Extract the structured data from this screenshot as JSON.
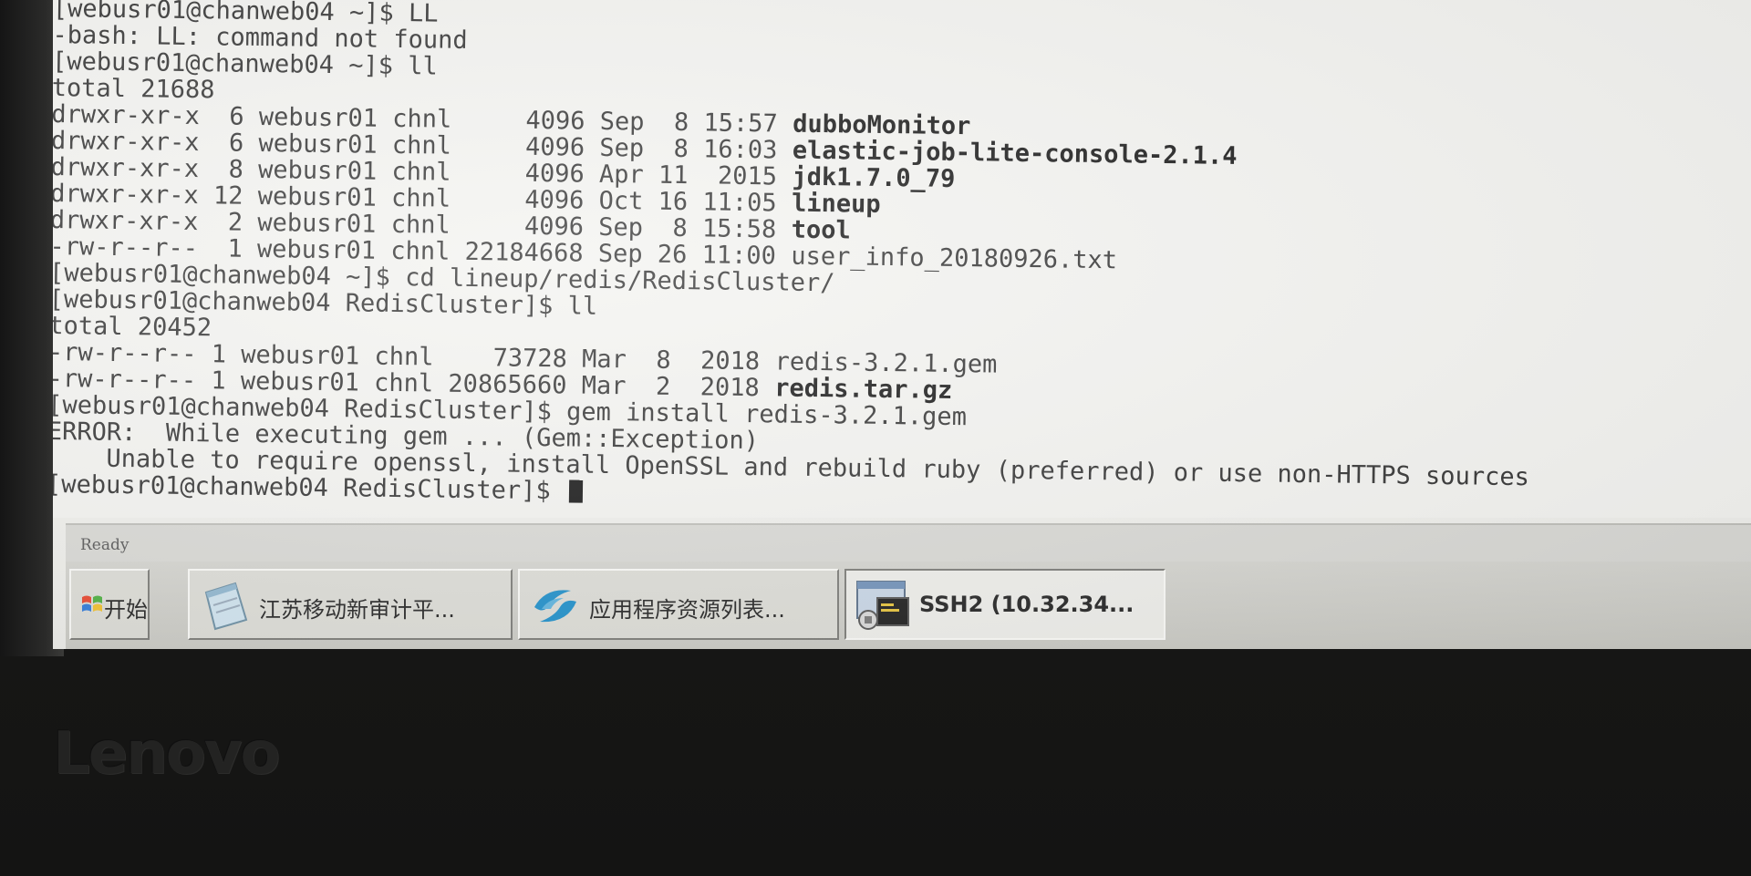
{
  "terminal": {
    "lines": [
      {
        "text": "[webusr01@chanweb04 ~]$ LL"
      },
      {
        "text": "-bash: LL: command not found"
      },
      {
        "text": "[webusr01@chanweb04 ~]$ ll"
      },
      {
        "text": "total 21688"
      },
      {
        "text": "drwxr-xr-x  6 webusr01 chnl     4096 Sep  8 15:57 ",
        "name": "dubboMonitor",
        "is_dir": true
      },
      {
        "text": "drwxr-xr-x  6 webusr01 chnl     4096 Sep  8 16:03 ",
        "name": "elastic-job-lite-console-2.1.4",
        "is_dir": true
      },
      {
        "text": "drwxr-xr-x  8 webusr01 chnl     4096 Apr 11  2015 ",
        "name": "jdk1.7.0_79",
        "is_dir": true
      },
      {
        "text": "drwxr-xr-x 12 webusr01 chnl     4096 Oct 16 11:05 ",
        "name": "lineup",
        "is_dir": true
      },
      {
        "text": "drwxr-xr-x  2 webusr01 chnl     4096 Sep  8 15:58 ",
        "name": "tool",
        "is_dir": true
      },
      {
        "text": "-rw-r--r--  1 webusr01 chnl 22184668 Sep 26 11:00 ",
        "name": "user_info_20180926.txt",
        "is_dir": false
      },
      {
        "text": "[webusr01@chanweb04 ~]$ cd lineup/redis/RedisCluster/"
      },
      {
        "text": "[webusr01@chanweb04 RedisCluster]$ ll"
      },
      {
        "text": "total 20452"
      },
      {
        "text": "-rw-r--r-- 1 webusr01 chnl    73728 Mar  8  2018 ",
        "name": "redis-3.2.1.gem",
        "is_dir": false
      },
      {
        "text": "-rw-r--r-- 1 webusr01 chnl 20865660 Mar  2  2018 ",
        "name": "redis.tar.gz",
        "is_dir": true
      },
      {
        "text": "[webusr01@chanweb04 RedisCluster]$ gem install redis-3.2.1.gem"
      },
      {
        "text": "ERROR:  While executing gem ... (Gem::Exception)"
      },
      {
        "text": "    Unable to require openssl, install OpenSSL and rebuild ruby (preferred) or use non-HTTPS sources"
      },
      {
        "text": "[webusr01@chanweb04 RedisCluster]$ ",
        "cursor": true
      }
    ]
  },
  "statusbar": {
    "text": "Ready"
  },
  "taskbar": {
    "start": {
      "label": "开始",
      "icon": "windows-flag-icon"
    },
    "tasks": [
      {
        "label": "江苏移动新审计平...",
        "icon": "notepad-icon",
        "active": false
      },
      {
        "label": "应用程序资源列表...",
        "icon": "china-mobile-logo-icon",
        "active": false
      },
      {
        "label": "SSH2 (10.32.34...",
        "icon": "ssh-terminal-icon",
        "active": true
      }
    ]
  },
  "bezel": {
    "logo": "Lenovo"
  },
  "colors": {
    "terminal_bg": "#f3f3f0",
    "terminal_fg": "#2f2f2f",
    "taskbar_bg": "#d4d4cf",
    "bezel": "#1c1c1b"
  }
}
